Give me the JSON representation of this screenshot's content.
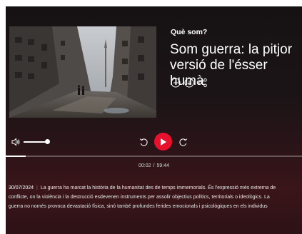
{
  "program": {
    "label": "Què som?"
  },
  "episode": {
    "title": "Som guerra: la pitjor versió de l'ésser humà"
  },
  "actions": [
    {
      "icon": "plus-circle-icon"
    },
    {
      "icon": "download-circle-icon"
    },
    {
      "icon": "share-icon"
    }
  ],
  "player": {
    "volume_level": 0.85,
    "progress_fraction": 0.016,
    "current_time": "00:02",
    "separator": "/",
    "duration": "59:44",
    "accent_color": "#e8112d"
  },
  "description": {
    "date": "30/07/2024",
    "line1": "La guerra ha marcat la història de la humanitat des de temps immemorials. És l'expressió més extrema de",
    "line2": "conflicte, on la violència i la destrucció esdevenen instruments per assolir objectius polítics, territorials o ideològics. La",
    "line3": "guerra no només provoca devastació física, sinó també profundes ferides emocionals i psicològiques en els individus"
  }
}
